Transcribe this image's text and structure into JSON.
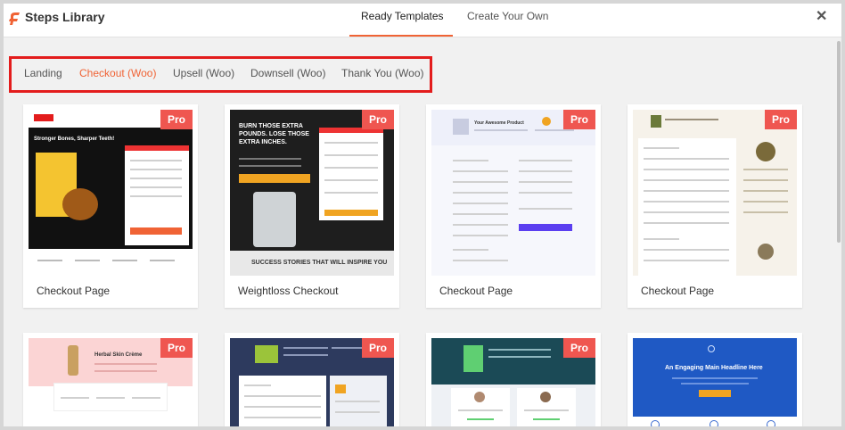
{
  "header": {
    "title": "Steps Library",
    "tabs": [
      {
        "label": "Ready Templates"
      },
      {
        "label": "Create Your Own"
      }
    ]
  },
  "filters": [
    {
      "label": "Landing"
    },
    {
      "label": "Checkout (Woo)"
    },
    {
      "label": "Upsell (Woo)"
    },
    {
      "label": "Downsell (Woo)"
    },
    {
      "label": "Thank You (Woo)"
    }
  ],
  "cards": [
    {
      "label": "Checkout Page",
      "badge": "Pro",
      "headline": "Stronger Bones, Sharper Teeth!"
    },
    {
      "label": "Weightloss Checkout",
      "badge": "Pro",
      "headline": "BURN THOSE EXTRA POUNDS. LOSE THOSE EXTRA INCHES.",
      "footer": "SUCCESS STORIES THAT WILL INSPIRE YOU"
    },
    {
      "label": "Checkout Page",
      "badge": "Pro",
      "headline": "Your Awesome Product"
    },
    {
      "label": "Checkout Page",
      "badge": "Pro"
    },
    {
      "label": "",
      "badge": "Pro",
      "headline": "Herbal Skin Crème"
    },
    {
      "label": "",
      "badge": "Pro"
    },
    {
      "label": "",
      "badge": "Pro"
    },
    {
      "label": "",
      "badge": "",
      "headline": "An Engaging Main Headline Here"
    }
  ],
  "colors": {
    "accent": "#f06335",
    "pro": "#ef5650",
    "highlight": "#e31c1c"
  }
}
